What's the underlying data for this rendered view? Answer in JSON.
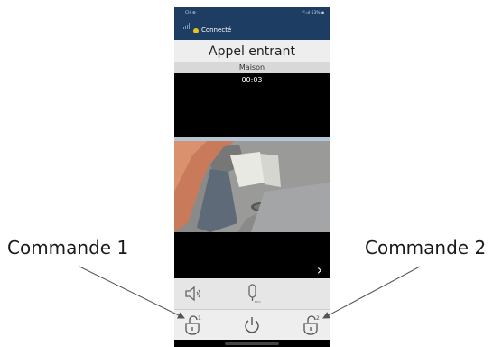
{
  "statusbar": {
    "clock": "CH ⊕",
    "system": "⁵ᴳ.ııl 63% ▪"
  },
  "connection": {
    "label": "Connecté",
    "dot_color": "#e6c51a"
  },
  "call": {
    "title": "Appel entrant",
    "location": "Maison",
    "timer": "00:03"
  },
  "controls": {
    "speaker_icon": "speaker-icon",
    "mic_icon": "microphone-icon",
    "command1_icon": "command-1-icon",
    "command1_badge": "1",
    "hangup_icon": "power-icon",
    "command2_icon": "command-2-icon",
    "command2_badge": "2"
  },
  "nav": {
    "next_glyph": "›"
  },
  "annotations": {
    "left": "Commande 1",
    "right": "Commande 2"
  },
  "colors": {
    "header": "#1d3d63",
    "title_bg": "#eeeeee",
    "controls_bg": "#e6e6e6"
  }
}
